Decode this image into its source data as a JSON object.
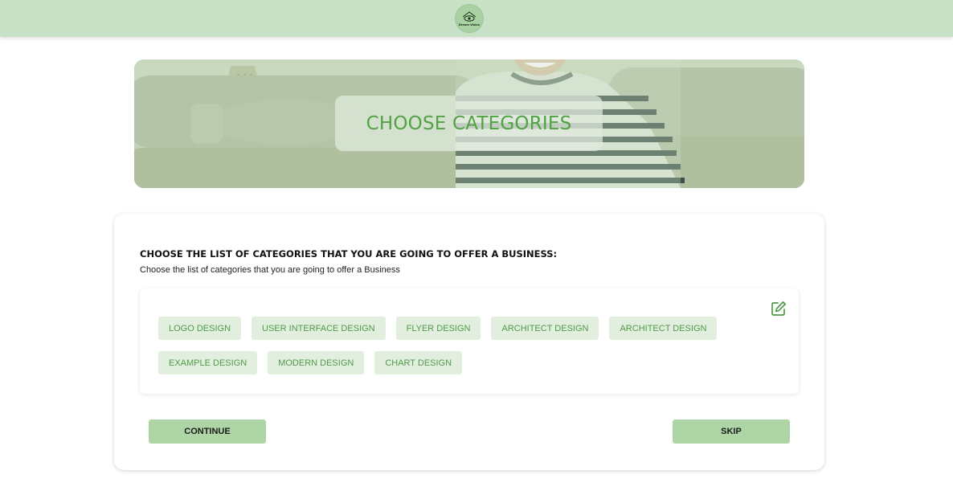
{
  "header": {
    "logo_icon": "eye-house-logo-icon",
    "logo_text": "Dream Vision"
  },
  "hero": {
    "title": "CHOOSE CATEGORIES",
    "image": "person-in-striped-shirt-on-sofa"
  },
  "form": {
    "heading": "CHOOSE THE LIST OF CATEGORIES THAT YOU ARE GOING TO OFFER A BUSINESS:",
    "subheading": "Choose the list of categories that you are going to offer a Business",
    "edit_icon": "edit-icon",
    "categories": [
      "LOGO DESIGN",
      "USER INTERFACE DESIGN",
      "FLYER DESIGN",
      "ARCHITECT DESIGN",
      "ARCHITECT DESIGN",
      "EXAMPLE DESIGN",
      "MODERN DESIGN",
      "CHART DESIGN"
    ],
    "continue_label": "CONTINUE",
    "skip_label": "SKIP"
  },
  "colors": {
    "header_bg": "#c8e0c6",
    "accent_green": "#52a145",
    "chip_bg": "#e2efdf",
    "button_bg": "#aed5a6"
  }
}
